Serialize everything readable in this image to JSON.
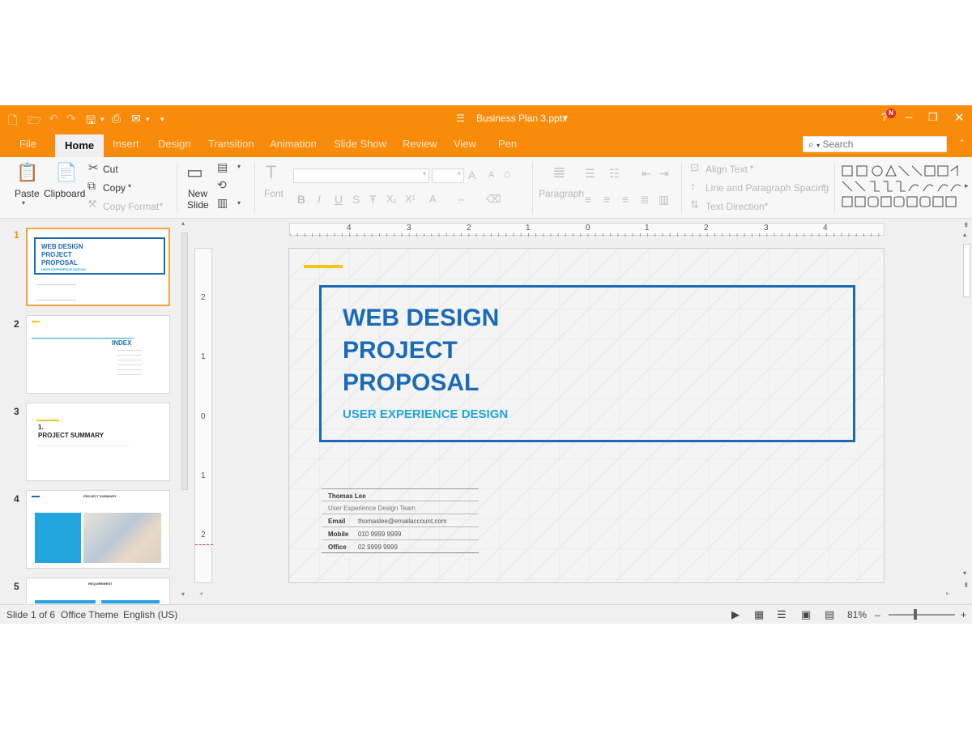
{
  "window": {
    "title": "Business Plan 3.pptx",
    "title_arrow": "▾",
    "controls": {
      "minimize": "–",
      "restore": "❐",
      "close": "✕"
    },
    "help_badge": "N"
  },
  "tabs": [
    {
      "label": "File",
      "active": false
    },
    {
      "label": "Home",
      "active": true
    },
    {
      "label": "Insert",
      "active": false
    },
    {
      "label": "Design",
      "active": false
    },
    {
      "label": "Transition",
      "active": false
    },
    {
      "label": "Animation",
      "active": false
    },
    {
      "label": "Slide Show",
      "active": false
    },
    {
      "label": "Review",
      "active": false
    },
    {
      "label": "View",
      "active": false
    },
    {
      "label": "Pen",
      "active": false
    }
  ],
  "search": {
    "placeholder": "Search"
  },
  "ribbon": {
    "paste": "Paste",
    "clipboard": "Clipboard",
    "cut": "Cut",
    "copy": "Copy",
    "copy_format": "Copy Format",
    "new_slide_line1": "New",
    "new_slide_line2": "Slide",
    "font": "Font",
    "paragraph": "Paragraph",
    "align_text": "Align Text",
    "line_spacing": "Line and Paragraph Spacing",
    "text_direction": "Text Direction"
  },
  "thumbnails": [
    {
      "num": "1",
      "active": true
    },
    {
      "num": "2",
      "active": false
    },
    {
      "num": "3",
      "active": false
    },
    {
      "num": "4",
      "active": false
    },
    {
      "num": "5",
      "active": false
    }
  ],
  "thumb_text": {
    "t1_line1": "WEB DESIGN",
    "t1_line2": "PROJECT",
    "t1_line3": "PROPOSAL",
    "t1_sub": "USER EXPERIENCE DESIGN",
    "t2_title": "INDEX",
    "t3_num": "1.",
    "t3_title": "PROJECT SUMMARY",
    "t4_title": "PROJECT SUMMARY",
    "t5_title": "REQUIREMENT"
  },
  "ruler_h": [
    "4",
    "3",
    "2",
    "1",
    "0",
    "1",
    "2",
    "3",
    "4"
  ],
  "ruler_v": [
    "2",
    "1",
    "0",
    "1",
    "2"
  ],
  "slide": {
    "title_lines": [
      "WEB DESIGN",
      "PROJECT",
      "PROPOSAL"
    ],
    "subtitle": "USER EXPERIENCE DESIGN",
    "contact": {
      "name": "Thomas Lee",
      "team": "User Experience Design Team",
      "rows": [
        {
          "key": "Email",
          "value": "thomaslee@emailaccount.com"
        },
        {
          "key": "Mobile",
          "value": "010 9999 9999"
        },
        {
          "key": "Office",
          "value": "02 9999 9999"
        }
      ]
    }
  },
  "status": {
    "slide_info": "Slide 1 of 6",
    "theme": "Office Theme",
    "language": "English (US)",
    "zoom": "81%",
    "zoom_minus": "–",
    "zoom_plus": "+"
  },
  "colors": {
    "accent": "#f98b0a",
    "slide_blue": "#1b6ab8",
    "slide_cyan": "#22a4df",
    "slide_yellow": "#f7c613"
  }
}
